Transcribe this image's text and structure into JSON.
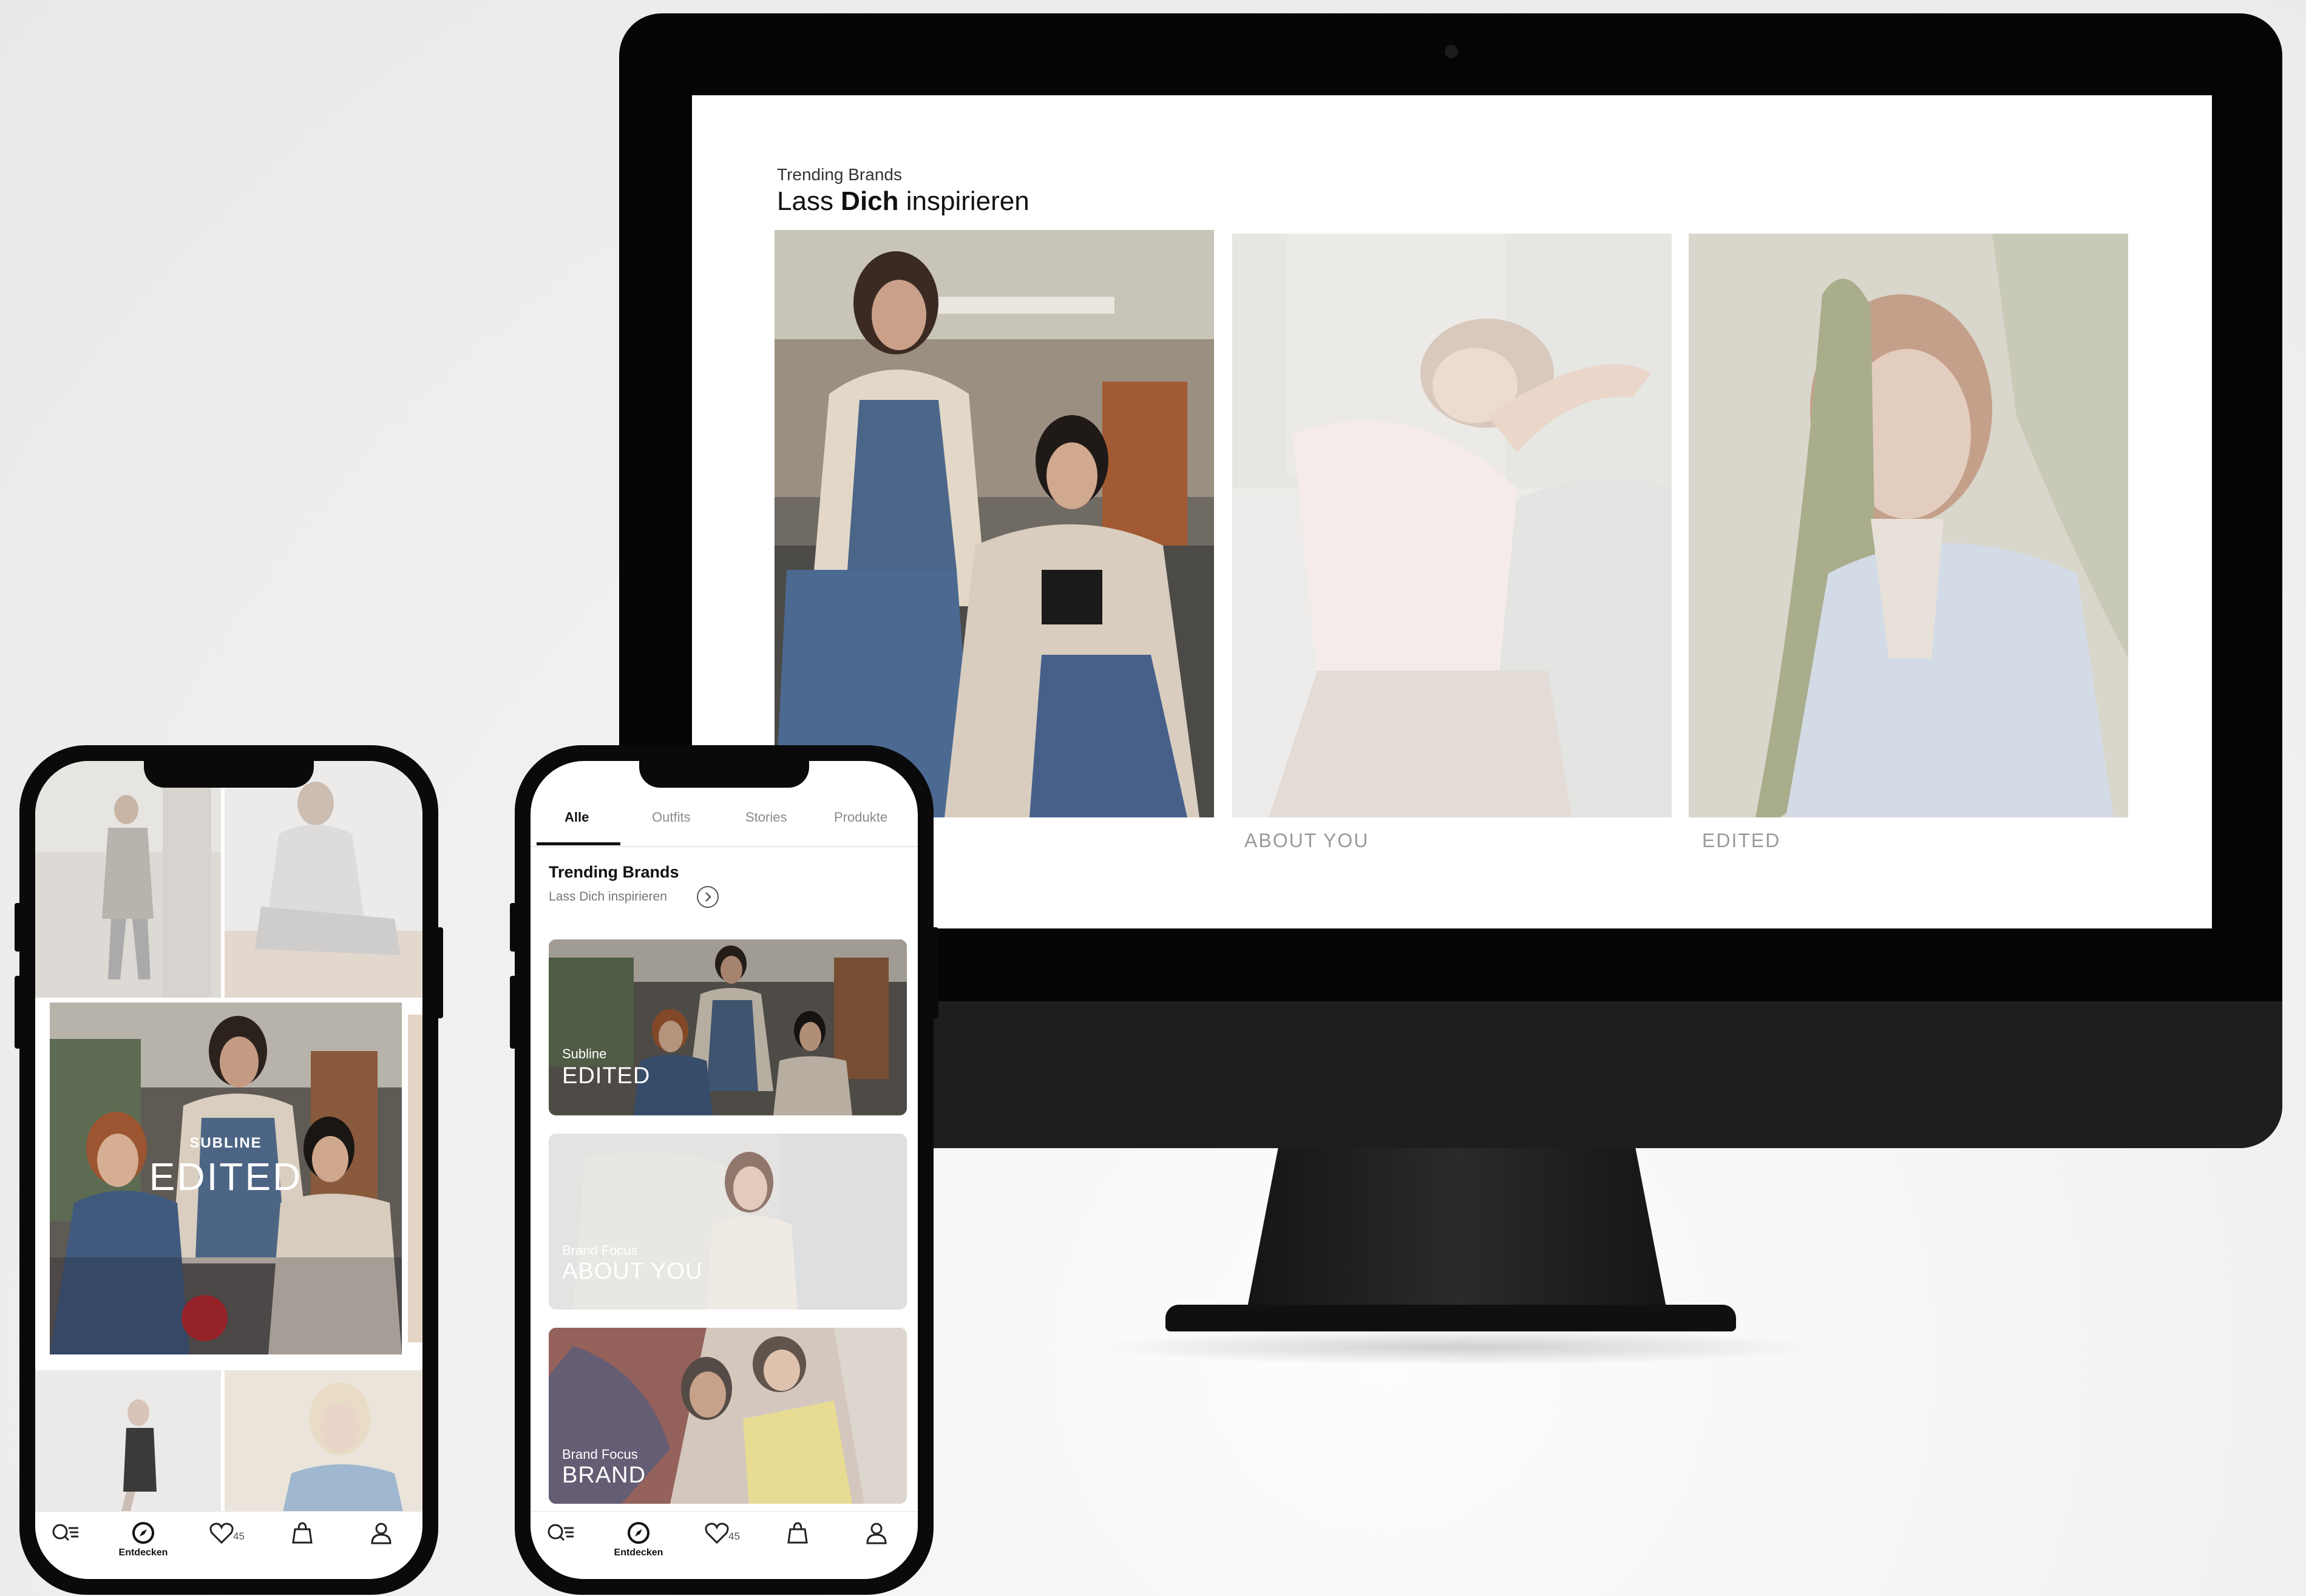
{
  "desktop": {
    "subtitle": "Trending Brands",
    "title_pre": "Lass ",
    "title_bold": "Dich",
    "title_post": " inspirieren",
    "brands": [
      {
        "label": ""
      },
      {
        "label": "ABOUT YOU"
      },
      {
        "label": "EDITED"
      }
    ]
  },
  "phone_left": {
    "hero_kicker": "SUBLINE",
    "hero_title": "EDITED",
    "tabbar": {
      "discover_label": "Entdecken",
      "wishlist_count": "45"
    }
  },
  "phone_right": {
    "tabs": [
      "Alle",
      "Outfits",
      "Stories",
      "Produkte"
    ],
    "active_tab": "Alle",
    "section_title": "Trending Brands",
    "section_subtitle": "Lass Dich inspirieren",
    "cards": [
      {
        "kicker": "Subline",
        "name": "EDITED"
      },
      {
        "kicker": "Brand Focus",
        "name": "ABOUT YOU"
      },
      {
        "kicker": "Brand Focus",
        "name": "BRAND"
      }
    ],
    "tabbar": {
      "discover_label": "Entdecken",
      "wishlist_count": "45"
    }
  }
}
